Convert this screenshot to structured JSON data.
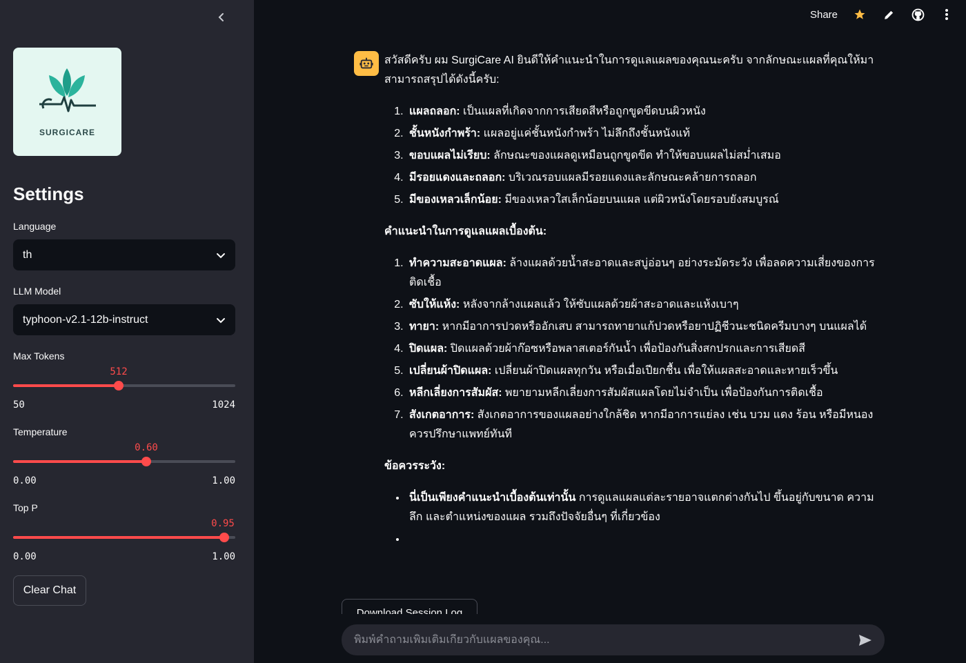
{
  "sidebar": {
    "collapse_icon": "chevron-left-icon",
    "logo_text": "SURGICARE",
    "settings_title": "Settings",
    "language": {
      "label": "Language",
      "value": "th"
    },
    "llm_model": {
      "label": "LLM Model",
      "value": "typhoon-v2.1-12b-instruct"
    },
    "max_tokens": {
      "label": "Max Tokens",
      "value": "512",
      "min": "50",
      "max": "1024",
      "fraction": 0.475
    },
    "temperature": {
      "label": "Temperature",
      "value": "0.60",
      "min": "0.00",
      "max": "1.00",
      "fraction": 0.6
    },
    "top_p": {
      "label": "Top P",
      "value": "0.95",
      "min": "0.00",
      "max": "1.00",
      "fraction": 0.95
    },
    "clear_label": "Clear Chat"
  },
  "header": {
    "share_label": "Share",
    "icons": [
      "star-icon",
      "pencil-icon",
      "github-icon",
      "more-vertical-icon"
    ]
  },
  "chat": {
    "assistant_icon": "robot-icon",
    "intro": "สวัสดีครับ ผม SurgiCare AI ยินดีให้คำแนะนำในการดูแลแผลของคุณนะครับ จากลักษณะแผลที่คุณให้มา สามารถสรุปได้ดังนี้ครับ:",
    "findings": [
      {
        "title": "แผลถลอก:",
        "text": " เป็นแผลที่เกิดจากการเสียดสีหรือถูกขูดขีดบนผิวหนัง"
      },
      {
        "title": "ชั้นหนังกำพร้า:",
        "text": " แผลอยู่แค่ชั้นหนังกำพร้า ไม่ลึกถึงชั้นหนังแท้"
      },
      {
        "title": "ขอบแผลไม่เรียบ:",
        "text": " ลักษณะของแผลดูเหมือนถูกขูดขีด ทำให้ขอบแผลไม่สม่ำเสมอ"
      },
      {
        "title": "มีรอยแดงและถลอก:",
        "text": " บริเวณรอบแผลมีรอยแดงและลักษณะคล้ายการถลอก"
      },
      {
        "title": "มีของเหลวเล็กน้อย:",
        "text": " มีของเหลวใสเล็กน้อยบนแผล แต่ผิวหนังโดยรอบยังสมบูรณ์"
      }
    ],
    "care_heading": "คำแนะนำในการดูแลแผลเบื้องต้น:",
    "care_steps": [
      {
        "title": "ทำความสะอาดแผล:",
        "text": " ล้างแผลด้วยน้ำสะอาดและสบู่อ่อนๆ อย่างระมัดระวัง เพื่อลดความเสี่ยงของการติดเชื้อ"
      },
      {
        "title": "ซับให้แห้ง:",
        "text": " หลังจากล้างแผลแล้ว ให้ซับแผลด้วยผ้าสะอาดและแห้งเบาๆ"
      },
      {
        "title": "ทายา:",
        "text": " หากมีอาการปวดหรืออักเสบ สามารถทายาแก้ปวดหรือยาปฏิชีวนะชนิดครีมบางๆ บนแผลได้"
      },
      {
        "title": "ปิดแผล:",
        "text": " ปิดแผลด้วยผ้าก๊อซหรือพลาสเตอร์กันน้ำ เพื่อป้องกันสิ่งสกปรกและการเสียดสี"
      },
      {
        "title": "เปลี่ยนผ้าปิดแผล:",
        "text": " เปลี่ยนผ้าปิดแผลทุกวัน หรือเมื่อเปียกชื้น เพื่อให้แผลสะอาดและหายเร็วขึ้น"
      },
      {
        "title": "หลีกเลี่ยงการสัมผัส:",
        "text": " พยายามหลีกเลี่ยงการสัมผัสแผลโดยไม่จำเป็น เพื่อป้องกันการติดเชื้อ"
      },
      {
        "title": "สังเกตอาการ:",
        "text": " สังเกตอาการของแผลอย่างใกล้ชิด หากมีอาการแย่ลง เช่น บวม แดง ร้อน หรือมีหนอง ควรปรึกษาแพทย์ทันที"
      }
    ],
    "caution_heading": "ข้อควรระวัง:",
    "cautions": [
      {
        "title": "นี่เป็นเพียงคำแนะนำเบื้องต้นเท่านั้น",
        "text": " การดูแลแผลแต่ละรายอาจแตกต่างกันไป ขึ้นอยู่กับขนาด ความลึก และตำแหน่งของแผล รวมถึงปัจจัยอื่นๆ ที่เกี่ยวข้อง"
      },
      {
        "title": "",
        "text": ""
      }
    ],
    "download_label": "Download Session Log",
    "input_placeholder": "พิมพ์คำถามเพิ่มเติมเกี่ยวกับแผลของคุณ...",
    "send_icon": "send-icon"
  }
}
